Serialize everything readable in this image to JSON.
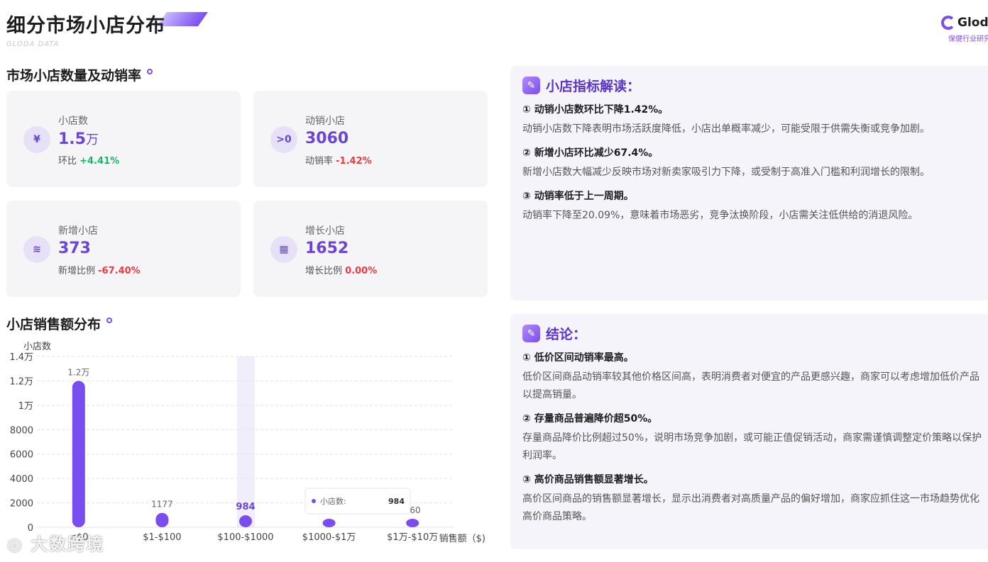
{
  "header": {
    "title": "细分市场小店分布",
    "subtitle": "GLODA DATA",
    "brand_name": "Gloda",
    "brand_tag": "保健行业研究"
  },
  "section1": {
    "title": "市场小店数量及动销率"
  },
  "cards": [
    {
      "icon": "¥",
      "label": "小店数",
      "value": "1.5",
      "unit": "万",
      "sub_label": "环比",
      "sub_value": "+4.41%"
    },
    {
      "icon": ">0",
      "label": "动销小店",
      "value": "3060",
      "unit": "",
      "sub_label": "动销率",
      "sub_value": "-1.42%"
    },
    {
      "icon": "≋",
      "label": "新增小店",
      "value": "373",
      "unit": "",
      "sub_label": "新增比例",
      "sub_value": "-67.40%"
    },
    {
      "icon": "▦",
      "label": "增长小店",
      "value": "1652",
      "unit": "",
      "sub_label": "增长比例",
      "sub_value": "0.00%"
    }
  ],
  "insight": {
    "title": "小店指标解读：",
    "points": [
      {
        "title": "① 动销小店数环比下降1.42%。",
        "body": "动销小店数下降表明市场活跃度降低，小店出单概率减少，可能受限于供需失衡或竞争加剧。"
      },
      {
        "title": "② 新增小店环比减少67.4%。",
        "body": "新增小店数大幅减少反映市场对新卖家吸引力下降，或受制于高准入门槛和利润增长的限制。"
      },
      {
        "title": "③ 动销率低于上一周期。",
        "body": "动销率下降至20.09%，意味着市场恶劣，竞争汰换阶段，小店需关注低供给的消退风险。"
      }
    ]
  },
  "conclusion": {
    "title": "结论：",
    "points": [
      {
        "title": "① 低价区间动销率最高。",
        "body": "低价区间商品动销率较其他价格区间高，表明消费者对便宜的产品更感兴趣，商家可以考虑增加低价产品以提高销量。"
      },
      {
        "title": "② 存量商品普遍降价超50%。",
        "body": "存量商品降价比例超过50%，说明市场竞争加剧，或可能正值促销活动，商家需谨慎调整定价策略以保护利润率。"
      },
      {
        "title": "③ 高价商品销售额显著增长。",
        "body": "高价区间商品的销售额显著增长，显示出消费者对高质量产品的偏好增加，商家应抓住这一市场趋势优化高价商品策略。"
      }
    ]
  },
  "section2": {
    "title": "小店销售额分布"
  },
  "chart_data": {
    "type": "bar",
    "ylabel": "小店数",
    "xlabel": "销售额（$)",
    "categories": [
      "<$0",
      "$1-$100",
      "$100-$1000",
      "$1000-$1万",
      "$1万-$10万"
    ],
    "values": [
      12000,
      1177,
      984,
      340,
      260
    ],
    "value_labels": [
      "1.2万",
      "1177",
      "984",
      "340",
      "260"
    ],
    "ylim": [
      0,
      14000
    ],
    "y_ticks": [
      0,
      2000,
      4000,
      6000,
      8000,
      10000,
      12000,
      14000
    ],
    "y_tick_labels": [
      "0",
      "2000",
      "4000",
      "6000",
      "8000",
      "1万",
      "1.2万",
      "1.4万"
    ],
    "grid": true,
    "highlighted_category": 2,
    "bar_color": "#7a4df0",
    "tooltip": {
      "series": "小店数:",
      "value": "984"
    }
  },
  "watermark": "大数跨境",
  "colors": {
    "accent": "#6b45d6",
    "positive": "#18b469",
    "negative": "#f0393f"
  }
}
